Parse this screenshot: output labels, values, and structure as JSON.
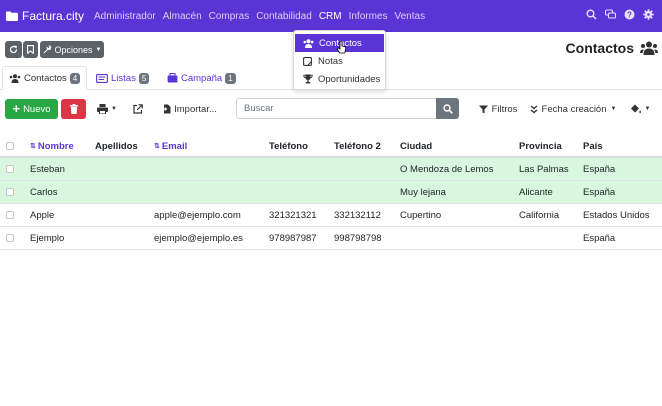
{
  "brand": "Factura.city",
  "nav": {
    "items": [
      "Administrador",
      "Almacén",
      "Compras",
      "Contabilidad",
      "CRM",
      "Informes",
      "Ventas"
    ],
    "active": "CRM"
  },
  "dropdown": {
    "items": [
      {
        "label": "Contactos",
        "icon": "users-icon"
      },
      {
        "label": "Notas",
        "icon": "note-icon"
      },
      {
        "label": "Oportunidades",
        "icon": "trophy-icon"
      }
    ]
  },
  "toolbar": {
    "options_label": "Opciones",
    "new_label": "Nuevo",
    "import_label": "Importar...",
    "filters_label": "Filtros",
    "sort_label": "Fecha creación"
  },
  "page_title": "Contactos",
  "tabs": [
    {
      "label": "Contactos",
      "count": "4"
    },
    {
      "label": "Listas",
      "count": "5"
    },
    {
      "label": "Campaña",
      "count": "1"
    }
  ],
  "search": {
    "placeholder": "Buscar"
  },
  "table": {
    "columns": [
      "Nombre",
      "Apellidos",
      "Email",
      "Teléfono",
      "Teléfono 2",
      "Ciudad",
      "Provincia",
      "País"
    ],
    "rows": [
      {
        "nombre": "Esteban",
        "apellidos": "",
        "email": "",
        "telefono": "",
        "telefono2": "",
        "ciudad": "O Mendoza de Lemos",
        "provincia": "Las Palmas",
        "pais": "España",
        "highlight": true
      },
      {
        "nombre": "Carlos",
        "apellidos": "",
        "email": "",
        "telefono": "",
        "telefono2": "",
        "ciudad": "Muy lejana",
        "provincia": "Alicante",
        "pais": "España",
        "highlight": true
      },
      {
        "nombre": "Apple",
        "apellidos": "",
        "email": "apple@ejemplo.com",
        "telefono": "321321321",
        "telefono2": "332132112",
        "ciudad": "Cupertino",
        "provincia": "California",
        "pais": "Estados Unidos",
        "highlight": false
      },
      {
        "nombre": "Ejemplo",
        "apellidos": "",
        "email": "ejemplo@ejemplo.es",
        "telefono": "978987987",
        "telefono2": "998798798",
        "ciudad": "",
        "provincia": "",
        "pais": "España",
        "highlight": false
      }
    ]
  },
  "colors": {
    "brand": "#5b34d6",
    "success": "#28a745",
    "danger": "#dc3545",
    "highlight_row": "#d9f7df"
  }
}
